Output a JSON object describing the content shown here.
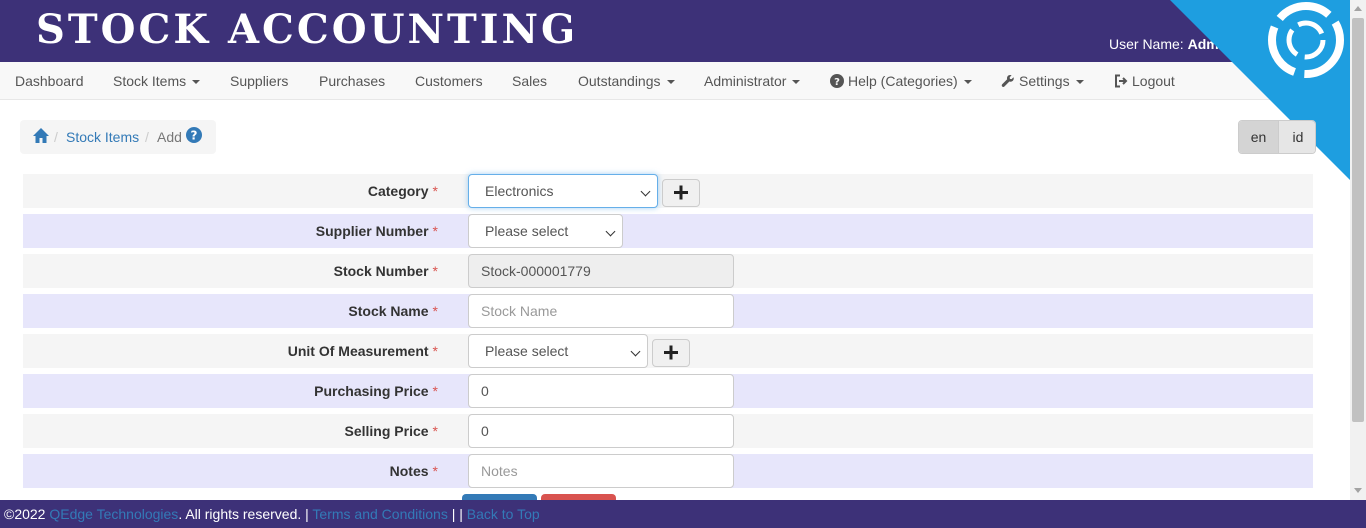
{
  "header": {
    "brand": "STOCK ACCOUNTING",
    "user_label": "User Name:",
    "user_name": "Adm"
  },
  "nav": {
    "items": [
      {
        "label": "Dashboard"
      },
      {
        "label": "Stock Items",
        "dropdown": true
      },
      {
        "label": "Suppliers"
      },
      {
        "label": "Purchases"
      },
      {
        "label": "Customers"
      },
      {
        "label": "Sales"
      },
      {
        "label": "Outstandings",
        "dropdown": true
      },
      {
        "label": "Administrator",
        "dropdown": true
      },
      {
        "label": "Help (Categories)",
        "dropdown": true,
        "icon": "question-circle-icon"
      },
      {
        "label": "Settings",
        "dropdown": true,
        "icon": "wrench-icon"
      },
      {
        "label": "Logout",
        "icon": "logout-icon"
      }
    ]
  },
  "breadcrumb": {
    "home_icon": "home-icon",
    "sep": "/",
    "items": [
      "Stock Items",
      "Add"
    ],
    "help_icon": "question-circle-icon"
  },
  "lang": {
    "options": [
      "en",
      "id"
    ],
    "selected": "en"
  },
  "form": {
    "required_mark": "*",
    "fields": [
      {
        "label": "Category",
        "type": "select",
        "value": "Electronics",
        "has_add": true
      },
      {
        "label": "Supplier Number",
        "type": "select",
        "value": "Please select"
      },
      {
        "label": "Stock Number",
        "type": "text",
        "value": "Stock-000001779",
        "disabled": true
      },
      {
        "label": "Stock Name",
        "type": "text",
        "placeholder": "Stock Name"
      },
      {
        "label": "Unit Of Measurement",
        "type": "select",
        "value": "Please select",
        "has_add": true
      },
      {
        "label": "Purchasing Price",
        "type": "text",
        "value": "0"
      },
      {
        "label": "Selling Price",
        "type": "text",
        "value": "0"
      },
      {
        "label": "Notes",
        "type": "text",
        "placeholder": "Notes"
      }
    ]
  },
  "footer": {
    "copyright": "©2022",
    "company": "QEdge Technologies",
    "rights": ". All rights reserved. |",
    "terms": "Terms and Conditions",
    "sep": "| |",
    "back": "Back to Top"
  },
  "colors": {
    "header_bg": "#3d3178",
    "ribbon": "#1e9ee0",
    "row_alt": "#e7e6fb",
    "link": "#337ab7",
    "required": "#d9534f"
  }
}
